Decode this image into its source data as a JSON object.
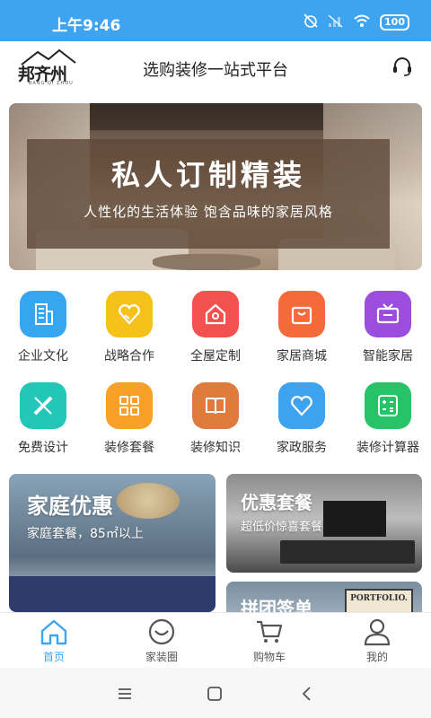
{
  "status_bar": {
    "time": "上午9:46",
    "battery": "100"
  },
  "header": {
    "logo_text": "邦齐州",
    "logo_sub": "BANG QI ZHOU",
    "title": "选购装修一站式平台"
  },
  "banner": {
    "title": "私人订制精装",
    "subtitle": "人性化的生活体验  饱含品味的家居风格"
  },
  "grid": {
    "row1": [
      {
        "label": "企业文化",
        "icon": "building-icon",
        "color": "#37a6f0"
      },
      {
        "label": "战略合作",
        "icon": "handshake-heart-icon",
        "color": "#f5c21b"
      },
      {
        "label": "全屋定制",
        "icon": "home-icon",
        "color": "#f2514f"
      },
      {
        "label": "家居商城",
        "icon": "shopping-bag-icon",
        "color": "#f46a3a"
      },
      {
        "label": "智能家居",
        "icon": "tv-icon",
        "color": "#9b4ddd"
      }
    ],
    "row2": [
      {
        "label": "免费设计",
        "icon": "ruler-pencil-icon",
        "color": "#23c7b7"
      },
      {
        "label": "装修套餐",
        "icon": "grid-icon",
        "color": "#f7a128"
      },
      {
        "label": "装修知识",
        "icon": "book-icon",
        "color": "#e07a3d"
      },
      {
        "label": "家政服务",
        "icon": "heart-icon",
        "color": "#3da3f0"
      },
      {
        "label": "装修计算器",
        "icon": "calculator-icon",
        "color": "#27c467"
      }
    ]
  },
  "promos": {
    "family": {
      "title": "家庭优惠",
      "subtitle": "家庭套餐，85㎡以上"
    },
    "package": {
      "title": "优惠套餐",
      "subtitle": "超低价惊喜套餐"
    },
    "group": {
      "title": "拼团签单",
      "poster": "PORTFOLIO."
    }
  },
  "tabbar": {
    "items": [
      {
        "label": "首页",
        "icon": "home-tab-icon",
        "active": true
      },
      {
        "label": "家装圈",
        "icon": "smile-circle-icon",
        "active": false
      },
      {
        "label": "购物车",
        "icon": "cart-icon",
        "active": false
      },
      {
        "label": "我的",
        "icon": "user-icon",
        "active": false
      }
    ]
  },
  "colors": {
    "status_bar": "#3fa4f0",
    "accent": "#3fa4f0",
    "banner_overlay": "#5f4837"
  }
}
